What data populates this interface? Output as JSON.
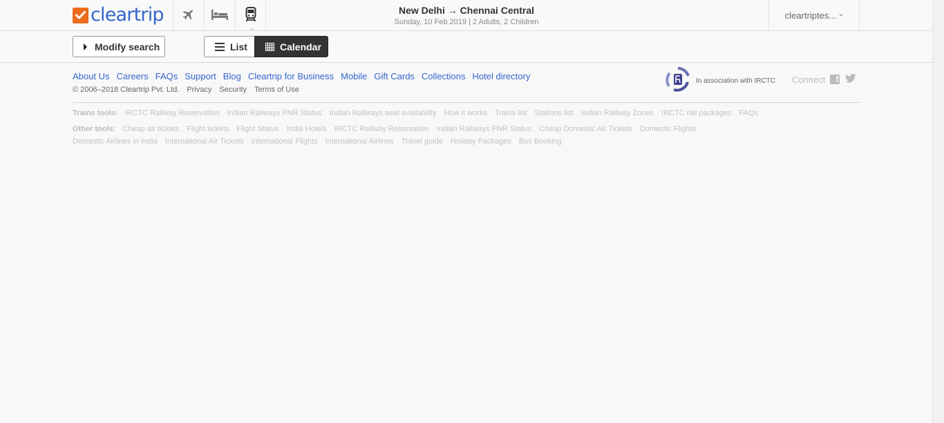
{
  "header": {
    "brand": "cleartrip",
    "tabs": [
      {
        "name": "flights",
        "icon": "airplane-icon"
      },
      {
        "name": "hotels",
        "icon": "bed-icon"
      },
      {
        "name": "trains",
        "icon": "train-icon",
        "active": true
      }
    ],
    "route_title": "New Delhi → Chennai Central",
    "route_subtitle": "Sunday, 10 Feb 2019 | 2 Adults, 2 Children",
    "account_label": "cleartriptes..."
  },
  "toolbar": {
    "modify_label": "Modify search",
    "list_label": "List",
    "calendar_label": "Calendar"
  },
  "footer": {
    "links": [
      "About Us",
      "Careers",
      "FAQs",
      "Support",
      "Blog",
      "Cleartrip for Business",
      "Mobile",
      "Gift Cards",
      "Collections",
      "Hotel directory"
    ],
    "copyright": "© 2006–2018 Cleartrip Pvt. Ltd.",
    "legal": [
      "Privacy",
      "Security",
      "Terms of Use"
    ],
    "irctc_text": "In association with IRCTC",
    "connect_label": "Connect",
    "trains_tools_label": "Trains tools:",
    "trains_tools": [
      "IRCTC Railway Reservation",
      "Indian Railways PNR Status",
      "Indian Railways seat availability",
      "How it works",
      "Trains list",
      "Stations list",
      "Indian Railway Zones",
      "IRCTC rail packages",
      "FAQs"
    ],
    "other_tools_label": "Other tools:",
    "other_tools": [
      "Cheap air tickets",
      "Flight tickets",
      "Flight Status",
      "India Hotels",
      "IRCTC Railway Reservation",
      "Indian Railways PNR Status",
      "Cheap Domestic Air Tickets",
      "Domestic Flights",
      "Domestic Airlines in India",
      "International Air Tickets",
      "International Flights",
      "International Airlines",
      "Travel guide",
      "Holiday Packages",
      "Bus Booking"
    ]
  },
  "colors": {
    "brand_orange": "#ec6b1e",
    "brand_blue": "#3366cc",
    "active_button": "#333333"
  }
}
